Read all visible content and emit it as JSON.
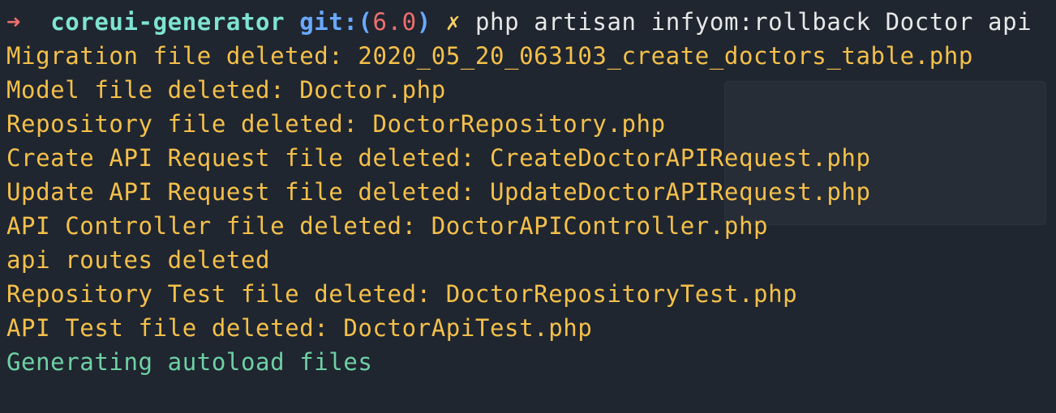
{
  "prompt": {
    "arrow": "➜",
    "directory": "coreui-generator",
    "git_prefix": "git:(",
    "branch": "6.0",
    "git_suffix": ")",
    "dirty_mark": "✗",
    "command": "php artisan infyom:rollback Doctor api"
  },
  "output": [
    "Migration file deleted: 2020_05_20_063103_create_doctors_table.php",
    "Model file deleted: Doctor.php",
    "Repository file deleted: DoctorRepository.php",
    "Create API Request file deleted: CreateDoctorAPIRequest.php",
    "Update API Request file deleted: UpdateDoctorAPIRequest.php",
    "API Controller file deleted: DoctorAPIController.php",
    "api routes deleted",
    "Repository Test file deleted: DoctorRepositoryTest.php",
    "API Test file deleted: DoctorApiTest.php"
  ],
  "final_message": "Generating autoload files",
  "colors": {
    "background": "#1f2630",
    "prompt_arrow": "#ef6f6c",
    "directory": "#7fe3d2",
    "git_label": "#6aa9ff",
    "branch": "#ef6f6c",
    "dirty_mark": "#f5d063",
    "command": "#e8e8e8",
    "output_text": "#f5c04a",
    "info_text": "#6fd1a4"
  }
}
